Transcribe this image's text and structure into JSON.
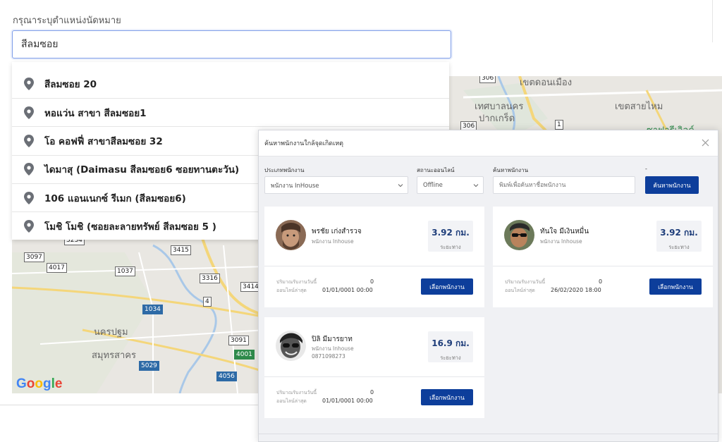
{
  "location": {
    "label": "กรุณาระบุตำแหน่งนัดหมาย",
    "value": "สีลมซอย"
  },
  "suggestions": [
    "สีลมซอย 20",
    "หอแว่น สาขา สีลมซอย1",
    "โอ คอฟฟี่ สาขาสีลมซอย 32",
    "ไดมาสุ (Daimasu สีลมซอย6 ซอยทานตะวัน)",
    "106 แอนเนกซ์ รีเมก (สีลมซอย6)",
    "โมชิ โมชิ (ซอยละลายทรัพย์ สีลมซอย 5 )"
  ],
  "map": {
    "places": {
      "p1": "เขตดอนเมือง",
      "p2": "เทศบาลนคร",
      "p3": "ปากเกร็ด",
      "p4": "เขตสายไหม",
      "p5": "ซาฟารีเวิลด์",
      "p6": "นครปฐม",
      "p7": "สมุทรสาคร"
    },
    "shields": {
      "s1": "306",
      "s2": "306",
      "s3": "1",
      "s4": "3234",
      "s5": "3415",
      "s6": "3097",
      "s7": "4017",
      "s8": "1037",
      "s9": "3316",
      "s10": "3414",
      "s11": "1034",
      "s12": "4",
      "s13": "3091",
      "s14": "4001",
      "s15": "5029",
      "s16": "4056"
    },
    "logo": "Google"
  },
  "modal": {
    "title": "ค้นหาพนักงานใกล้จุดเกิดเหตุ",
    "filters": {
      "type_label": "ประเภทพนักงาน",
      "type_value": "พนักงาน InHouse",
      "status_label": "สถานะออนไลน์",
      "status_value": "Offline",
      "search_label": "ค้นหาพนักงาน",
      "search_placeholder": "พิมพ์เพื่อค้นหาชื่อพนักงาน",
      "dash": "-",
      "search_button": "ค้นหาพนักงาน"
    },
    "stat_labels": {
      "jobs_today": "ปริมาณรับงานวันนี้",
      "last_online": "ออนไลน์ล่าสุด",
      "distance": "ระยะทาง",
      "select_button": "เลือกพนักงาน"
    },
    "employees": [
      {
        "name": "พรชัย เก่งสำรวจ",
        "type": "พนักงาน Inhouse",
        "phone": "",
        "distance": "3.92 กม.",
        "jobs_today": "0",
        "last_online": "01/01/0001 00:00"
      },
      {
        "name": "ทันใจ มีเงินหมื่น",
        "type": "พนักงาน Inhouse",
        "phone": "",
        "distance": "3.92 กม.",
        "jobs_today": "0",
        "last_online": "26/02/2020 18:00"
      },
      {
        "name": "ปิลิ มีมารยาท",
        "type": "พนักงาน Inhouse",
        "phone": "0871098273",
        "distance": "16.9 กม.",
        "jobs_today": "0",
        "last_online": "01/01/0001 00:00"
      }
    ]
  },
  "colors": {
    "primary": "#0d3e9b",
    "distance_text": "#1e3d7a",
    "input_focus": "#7f9ee8"
  }
}
